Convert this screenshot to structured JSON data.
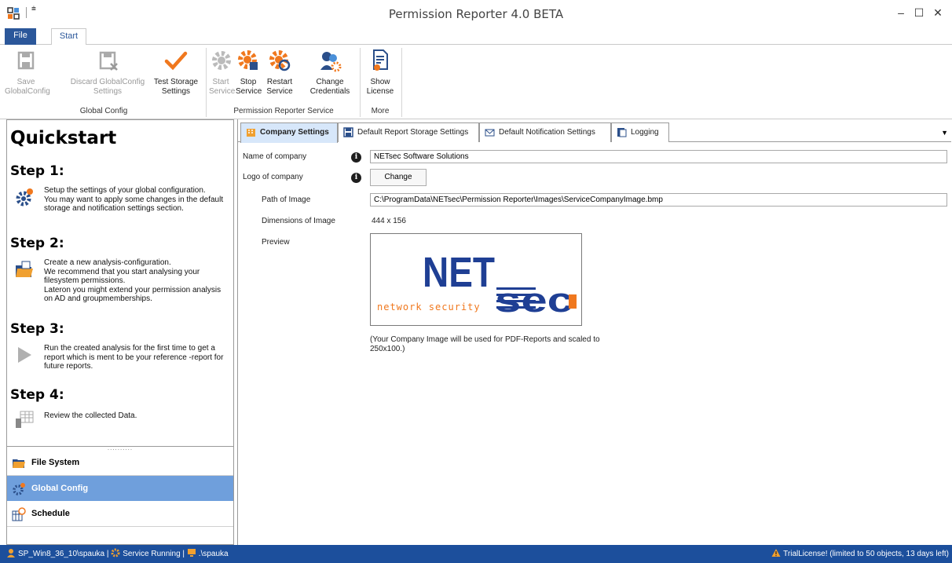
{
  "window": {
    "title": "Permission Reporter 4.0 BETA",
    "qat_symbol": "⩧",
    "minimize": "–",
    "maximize": "☐",
    "close": "✕"
  },
  "ribbon_tabs": {
    "file": "File",
    "start": "Start"
  },
  "ribbon": {
    "global_config": {
      "label": "Global Config",
      "save": "Save\nGlobalConfig",
      "discard": "Discard GlobalConfig\nSettings",
      "test_storage": "Test Storage\nSettings"
    },
    "service": {
      "label": "Permission Reporter Service",
      "start": "Start\nService",
      "stop": "Stop\nService",
      "restart": "Restart\nService",
      "change_credentials": "Change\nCredentials"
    },
    "more": {
      "label": "More",
      "show_license": "Show\nLicense"
    }
  },
  "quickstart": {
    "title": "Quickstart",
    "steps": [
      {
        "heading": "Step 1:",
        "text": "Setup the settings of your global configuration.\nYou may want to apply some changes in the default storage and notification settings section."
      },
      {
        "heading": "Step 2:",
        "text": "Create a new analysis-configuration.\nWe recommend that you start analysing your filesystem permissions.\nLateron you might extend your permission analysis on AD and groupmemberships."
      },
      {
        "heading": "Step 3:",
        "text": "Run the created analysis for the first time to get a report which is ment to be your reference -report for future reports."
      },
      {
        "heading": "Step 4:",
        "text": "Review the collected Data."
      }
    ],
    "splitter": "..........",
    "nav": [
      "File System",
      "Global Config",
      "Schedule"
    ]
  },
  "tabs": [
    "Company Settings",
    "Default Report Storage Settings",
    "Default Notification Settings",
    "Logging"
  ],
  "tab_menu": "▼",
  "company": {
    "name_label": "Name of company",
    "name_value": "NETsec Software Solutions",
    "logo_label": "Logo of company",
    "change_button": "Change",
    "path_label": "Path of Image",
    "path_value": "C:\\ProgramData\\NETsec\\Permission Reporter\\Images\\ServiceCompanyImage.bmp",
    "dimensions_label": "Dimensions of Image",
    "dimensions_value": "444 x 156",
    "preview_label": "Preview",
    "logo_text": {
      "net": "NET",
      "sec": "sec",
      "dot": ".",
      "tagline": "network security"
    },
    "note": "(Your Company Image will be used for PDF-Reports and scaled to 250x100.)"
  },
  "status": {
    "host": "SP_Win8_36_10\\spauka",
    "service": "Service Running",
    "user": ".\\spauka",
    "separator": "|",
    "license": "TrialLicense! (limited to 50 objects, 13 days left)"
  },
  "colors": {
    "accent": "#2b579a",
    "statusbar": "#1c4f9c",
    "nav_active": "#6f9fdc",
    "tab_active": "#d7e7fa",
    "orange": "#f0781e",
    "logo_blue": "#1f3f94"
  }
}
